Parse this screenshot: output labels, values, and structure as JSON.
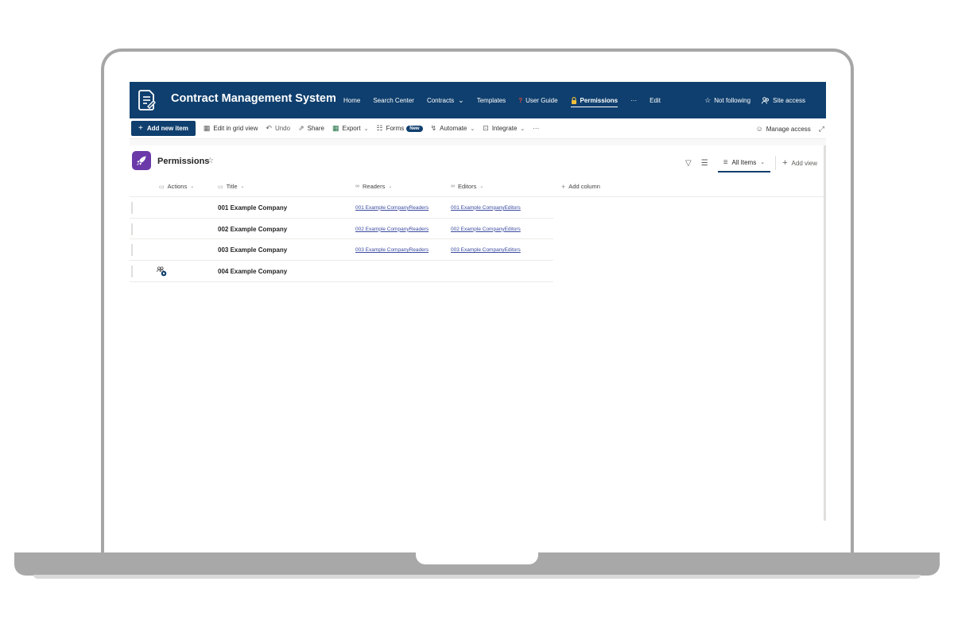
{
  "header": {
    "site_title": "Contract Management System",
    "nav": [
      {
        "label": "Home"
      },
      {
        "label": "Search Center"
      },
      {
        "label": "Contracts"
      },
      {
        "label": "Templates"
      },
      {
        "label": "User Guide"
      },
      {
        "label": "Permissions"
      },
      {
        "label": "···"
      },
      {
        "label": "Edit"
      }
    ],
    "not_following": "Not following",
    "site_access": "Site access"
  },
  "commandbar": {
    "add_new_item": "Add new item",
    "edit_grid": "Edit in grid view",
    "undo": "Undo",
    "share": "Share",
    "export": "Export",
    "forms": "Forms",
    "forms_badge": "New",
    "automate": "Automate",
    "integrate": "Integrate",
    "more": "···",
    "manage_access": "Manage access"
  },
  "list": {
    "title": "Permissions",
    "view_name": "All Items",
    "add_view": "Add view",
    "accent_color": "#6b3aa8"
  },
  "columns": {
    "actions": "Actions",
    "title": "Title",
    "readers": "Readers",
    "editors": "Editors",
    "add_column": "Add column"
  },
  "rows": [
    {
      "title": "001 Example Company",
      "readers": "001 Example CompanyReaders",
      "editors": "001 Example CompanyEditors"
    },
    {
      "title": "002 Example Company",
      "readers": "002 Example CompanyReaders",
      "editors": "002 Example CompanyEditors"
    },
    {
      "title": "003 Example Company",
      "readers": "003 Example CompanyReaders",
      "editors": "003 Example CompanyEditors"
    },
    {
      "title": "004 Example Company",
      "readers": "",
      "editors": ""
    }
  ],
  "theme": {
    "suitebar_color": "#0f3f6e",
    "link_color": "#3b4ba0"
  }
}
